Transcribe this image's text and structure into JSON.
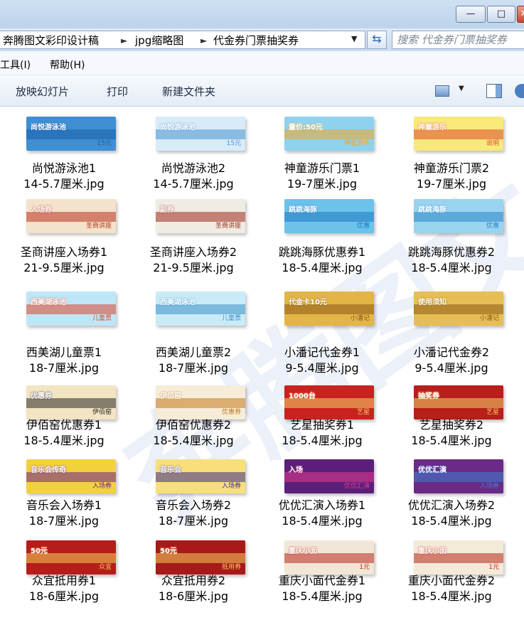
{
  "address": {
    "crumbs": [
      "奔腾图文彩印设计稿",
      "jpg缩略图",
      "代金券门票抽奖券"
    ],
    "search_placeholder": "搜索 代金券门票抽奖券"
  },
  "menu": {
    "tools": "工具(I)",
    "help": "帮助(H)"
  },
  "toolbar": {
    "slideshow": "放映幻灯片",
    "print": "打印",
    "new_folder": "新建文件夹"
  },
  "watermark": "奔腾图文",
  "files": [
    {
      "name": "尚悦游泳池1",
      "size": "14-5.7厘米.jpg",
      "thumb": {
        "bg": "#3f8fd2",
        "accent": "#1b5fa8",
        "text": "尚悦游泳池",
        "sub": "15元"
      }
    },
    {
      "name": "尚悦游泳池2",
      "size": "14-5.7厘米.jpg",
      "thumb": {
        "bg": "#d8ecf8",
        "accent": "#4b93d0",
        "text": "尚悦游泳池",
        "sub": "15元"
      }
    },
    {
      "name": "神童游乐门票1",
      "size": "19-7厘米.jpg",
      "thumb": {
        "bg": "#8fd2ee",
        "accent": "#f4a623",
        "text": "童价:50元",
        "sub": "神童游乐"
      }
    },
    {
      "name": "神童游乐门票2",
      "size": "19-7厘米.jpg",
      "thumb": {
        "bg": "#f7e97a",
        "accent": "#e04a2e",
        "text": "神童游乐",
        "sub": "说明"
      }
    },
    {
      "name": "圣商讲座入场券1",
      "size": "21-9.5厘米.jpg",
      "thumb": {
        "bg": "#f3e2cc",
        "accent": "#b8321e",
        "text": "入场券",
        "sub": "圣商讲座"
      }
    },
    {
      "name": "圣商讲座入场券2",
      "size": "21-9.5厘米.jpg",
      "thumb": {
        "bg": "#f1ece3",
        "accent": "#9a2a1a",
        "text": "副券",
        "sub": "圣商讲座"
      }
    },
    {
      "name": "跳跳海豚优惠券1",
      "size": "18-5.4厘米.jpg",
      "thumb": {
        "bg": "#6cc2ea",
        "accent": "#1f78c1",
        "text": "跳跳海豚",
        "sub": "优惠"
      }
    },
    {
      "name": "跳跳海豚优惠券2",
      "size": "18-5.4厘米.jpg",
      "thumb": {
        "bg": "#9ad4f0",
        "accent": "#2a86c9",
        "text": "跳跳海豚",
        "sub": "优惠"
      }
    },
    {
      "name": "西美湖儿童票1",
      "size": "18-7厘米.jpg",
      "thumb": {
        "bg": "#bfe6f6",
        "accent": "#e0462d",
        "text": "西美湖泳池",
        "sub": "儿童票"
      }
    },
    {
      "name": "西美湖儿童票2",
      "size": "18-7厘米.jpg",
      "thumb": {
        "bg": "#c9ebf7",
        "accent": "#3a8fc9",
        "text": "西美湖泳池",
        "sub": "儿童票"
      }
    },
    {
      "name": "小潘记代金券1",
      "size": "9-5.4厘米.jpg",
      "thumb": {
        "bg": "#e2b547",
        "accent": "#8a5a12",
        "text": "代金卡10元",
        "sub": "小潘记"
      }
    },
    {
      "name": "小潘记代金券2",
      "size": "9-5.4厘米.jpg",
      "thumb": {
        "bg": "#e6be55",
        "accent": "#8a5a12",
        "text": "使用须知",
        "sub": "小潘记"
      }
    },
    {
      "name": "伊佰窑优惠券1",
      "size": "18-5.4厘米.jpg",
      "thumb": {
        "bg": "#f3e4c2",
        "accent": "#2a2a2a",
        "text": "优惠券",
        "sub": "伊佰窑"
      }
    },
    {
      "name": "伊佰窑优惠券2",
      "size": "18-5.4厘米.jpg",
      "thumb": {
        "bg": "#f6ecd8",
        "accent": "#c27a1c",
        "text": "伊佰窑",
        "sub": "优惠券"
      }
    },
    {
      "name": "艺星抽奖券1",
      "size": "18-5.4厘米.jpg",
      "thumb": {
        "bg": "#c8231f",
        "accent": "#f2d36b",
        "text": "1000台",
        "sub": "艺星"
      }
    },
    {
      "name": "艺星抽奖券2",
      "size": "18-5.4厘米.jpg",
      "thumb": {
        "bg": "#b81e1a",
        "accent": "#f2d36b",
        "text": "抽奖券",
        "sub": "艺星"
      }
    },
    {
      "name": "音乐会入场券1",
      "size": "18-7厘米.jpg",
      "thumb": {
        "bg": "#f2d23c",
        "accent": "#6b1f8f",
        "text": "音乐会传奇",
        "sub": "入场券"
      }
    },
    {
      "name": "音乐会入场券2",
      "size": "18-7厘米.jpg",
      "thumb": {
        "bg": "#f7e07a",
        "accent": "#3d2a8c",
        "text": "音乐会",
        "sub": "入场券"
      }
    },
    {
      "name": "优优汇演入场券1",
      "size": "18-5.4厘米.jpg",
      "thumb": {
        "bg": "#5b1f7a",
        "accent": "#e33a8e",
        "text": "入场",
        "sub": "优优汇演"
      }
    },
    {
      "name": "优优汇演入场券2",
      "size": "18-5.4厘米.jpg",
      "thumb": {
        "bg": "#6a2a86",
        "accent": "#3a7fd1",
        "text": "优优汇演",
        "sub": "入场券"
      }
    },
    {
      "name": "众宜抵用券1",
      "size": "18-6厘米.jpg",
      "thumb": {
        "bg": "#b51d1a",
        "accent": "#f4cf5c",
        "text": "50元",
        "sub": "众宜"
      }
    },
    {
      "name": "众宜抵用券2",
      "size": "18-6厘米.jpg",
      "thumb": {
        "bg": "#a8191a",
        "accent": "#f4cf5c",
        "text": "50元",
        "sub": "抵用券"
      }
    },
    {
      "name": "重庆小面代金券1",
      "size": "18-5.4厘米.jpg",
      "thumb": {
        "bg": "#f2e7d6",
        "accent": "#b8261b",
        "text": "重庆小面",
        "sub": "1元"
      }
    },
    {
      "name": "重庆小面代金券2",
      "size": "18-5.4厘米.jpg",
      "thumb": {
        "bg": "#f4ead8",
        "accent": "#b8261b",
        "text": "重庆小面",
        "sub": "1元"
      }
    }
  ]
}
